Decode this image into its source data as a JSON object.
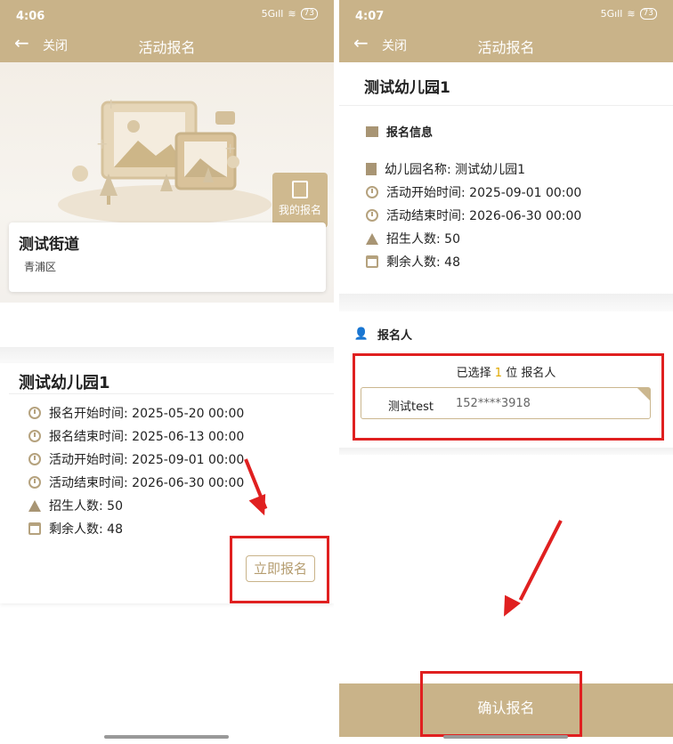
{
  "left": {
    "status": {
      "time": "4:06",
      "signal": "5Gıll",
      "battery": "73"
    },
    "header": {
      "close_label": "关闭",
      "title": "活动报名"
    },
    "my_signup_label": "我的报名",
    "district_card": {
      "name": "测试街道",
      "sub": "青浦区"
    },
    "kindergarten": {
      "name": "测试幼儿园1",
      "rows": [
        {
          "label": "报名开始时间: 2025-05-20 00:00"
        },
        {
          "label": "报名结束时间: 2025-06-13 00:00"
        },
        {
          "label": "活动开始时间: 2025-09-01 00:00"
        },
        {
          "label": "活动结束时间: 2026-06-30 00:00"
        },
        {
          "label": "招生人数: 50"
        },
        {
          "label": "剩余人数: 48"
        }
      ],
      "signup_button": "立即报名"
    }
  },
  "right": {
    "status": {
      "time": "4:07",
      "signal": "5Gıll",
      "battery": "73"
    },
    "header": {
      "close_label": "关闭",
      "title": "活动报名"
    },
    "kindergarten_name": "测试幼儿园1",
    "info_section": {
      "title": "报名信息",
      "rows": [
        {
          "label": "幼儿园名称: 测试幼儿园1"
        },
        {
          "label": "活动开始时间: 2025-09-01 00:00"
        },
        {
          "label": "活动结束时间: 2026-06-30 00:00"
        },
        {
          "label": "招生人数: 50"
        },
        {
          "label": "剩余人数: 48"
        }
      ]
    },
    "applicant_section": {
      "title": "报名人",
      "selected_prefix": "已选择",
      "selected_count": "1",
      "selected_suffix": "位 报名人",
      "person": {
        "name": "测试test",
        "phone": "152****3918"
      }
    },
    "confirm_button": "确认报名"
  },
  "colors": {
    "brand": "#c9b389",
    "accent_icon": "#a89574",
    "highlight": "#e02020",
    "count": "#e0a800"
  }
}
